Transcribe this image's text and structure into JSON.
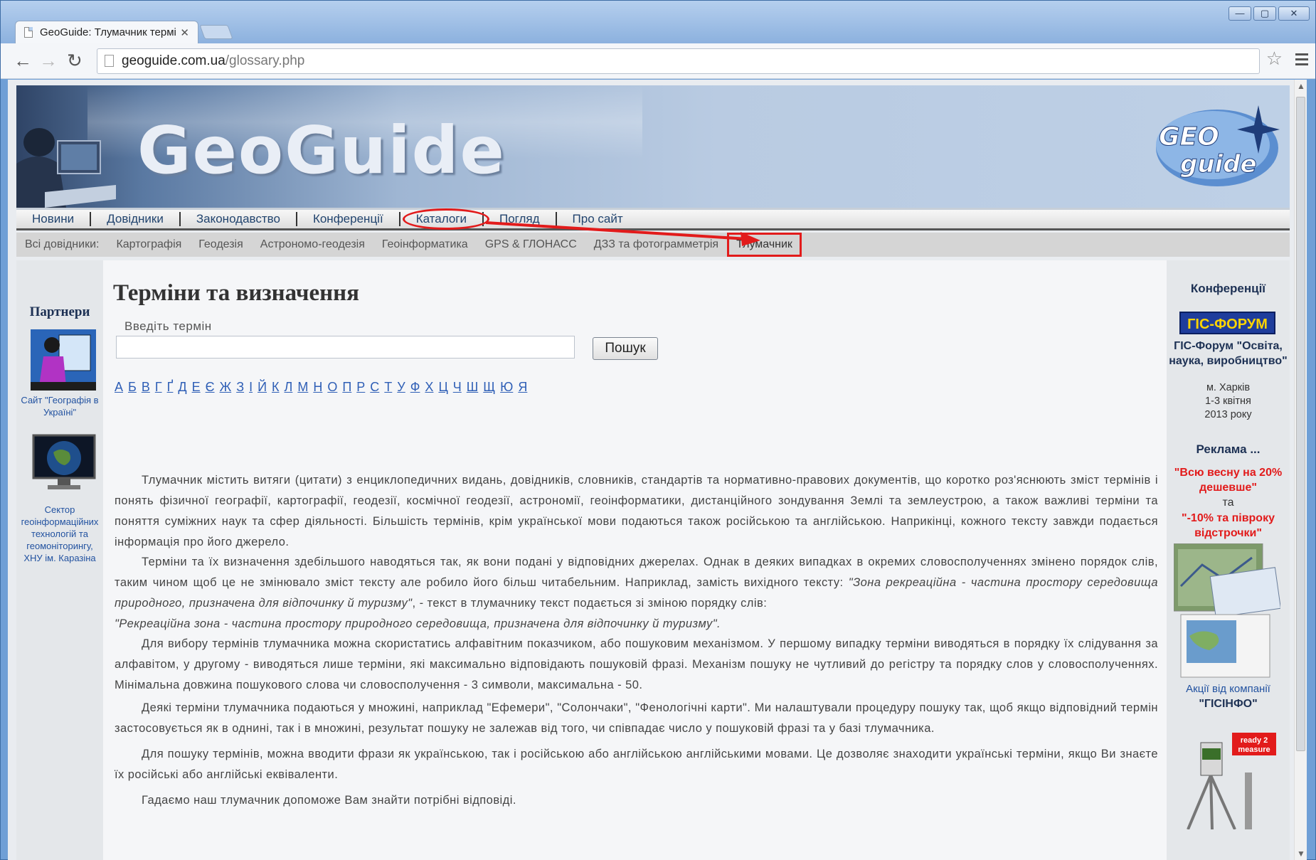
{
  "browser": {
    "tab_title": "GeoGuide: Тлумачник термі",
    "tab_close": "✕",
    "url_host": "geoguide.com.ua",
    "url_path": "/glossary.php",
    "window_buttons": [
      "—",
      "▢",
      "✕"
    ]
  },
  "site": {
    "logo_text": "GeoGuide",
    "badge_top": "GEO",
    "badge_bottom": "guide"
  },
  "nav_main": [
    "Новини",
    "Довідники",
    "Законодавство",
    "Конференції",
    "Каталоги",
    "Погляд",
    "Про сайт"
  ],
  "nav_sub": {
    "label": "Всі довідники:",
    "items": [
      "Картографія",
      "Геодезія",
      "Астрономо-геодезія",
      "Геоінформатика",
      "GPS & ГЛОНАСС",
      "ДЗЗ та фотограмметрія",
      "Тлумачник"
    ]
  },
  "left": {
    "title": "Партнери",
    "partner1": "Сайт \"Географія в Україні\"",
    "partner2": "Сектор геоінформаційних технологій та геомоніторингу, ХНУ ім. Каразіна"
  },
  "main": {
    "title": "Терміни та визначення",
    "search_label": "Введіть термін",
    "search_button": "Пошук",
    "alphabet": [
      "А",
      "Б",
      "В",
      "Г",
      "Ґ",
      "Д",
      "Е",
      "Є",
      "Ж",
      "З",
      "І",
      "Й",
      "К",
      "Л",
      "М",
      "Н",
      "О",
      "П",
      "Р",
      "С",
      "Т",
      "У",
      "Ф",
      "Х",
      "Ц",
      "Ч",
      "Ш",
      "Щ",
      "Ю",
      "Я"
    ],
    "p1": "Тлумачник містить витяги (цитати) з енциклопедичних видань, довідників, словників, стандартів та нормативно-правових документів, що коротко роз'яснюють зміст термінів і понять фізичної географії, картографії, геодезії, космічної геодезії, астрономії, геоінформатики, дистанційного зондування Землі та землеустрою, а також важливі терміни та поняття суміжних наук та сфер діяльності. Більшість термінів, крім української мови подаються також російською та англійською. Наприкінці, кожного тексту завжди подається інформація про його джерело.",
    "p2a": "Терміни та їх визначення здебільшого наводяться так, як вони подані у відповідних джерелах. Однак в деяких випадках в окремих словосполученнях змінено порядок слів, таким чином щоб це не змінювало зміст тексту але робило його більш читабельним. Наприклад, замість вихідного тексту: ",
    "p2b": "\"Зона рекреаційна - частина простору середовища природного, призначена для відпочинку й туризму\"",
    "p2c": ", - текст в тлумачнику текст подається зі зміною порядку слів:",
    "p2d": "\"Рекреаційна зона - частина простору природного середовища, призначена для відпочинку й туризму\".",
    "p3": "Для вибору термінів тлумачника можна скористатись алфавітним показчиком, або пошуковим механізмом. У першому випадку терміни виводяться в порядку їх слідування за алфавітом, у другому - виводяться лише терміни, які максимально відповідають пошуковій фразі. Механізм пошуку не чутливий до регістру та порядку слов у словосполученнях. Мінімальна довжина пошукового слова чи словосполучення - 3 символи, максимальна - 50.",
    "p4": "Деякі терміни тлумачника подаються у множині, наприклад \"Ефемери\", \"Солончаки\", \"Фенологічні карти\". Ми налаштували процедуру пошуку так, щоб якщо відповідний термін застосовується як в однині, так і в множині, результат пошуку не залежав від того, чи співпадає число у пошуковій фразі та у базі тлумачника.",
    "p5": "Для пошуку термінів, можна вводити фрази як українською, так і російською або англійською англійськими мовами. Це дозволяє знаходити українські терміни, якщо Ви знаєте їх російські або англійські еквіваленти.",
    "p6": "Гадаємо наш тлумачник допоможе Вам знайти потрібні відповіді."
  },
  "right": {
    "conf_title": "Конференції",
    "gis_logo": "ГІС-ФОРУМ",
    "conf_name": "ГІС-Форум \"Освіта, наука, виробництво\"",
    "conf_city": "м. Харків",
    "conf_date": "1-3 квітня",
    "conf_year": "2013 року",
    "ad_title": "Реклама ...",
    "ad1": "\"Всю весну на 20% дешевше\"",
    "ad_and": "та",
    "ad2": "\"-10% та півроку відстрочки\"",
    "ad_company": "Акції від компанії",
    "ad_company_name": "\"ГІСІНФО\"",
    "ready_badge": "ready 2 measure"
  },
  "colors": {
    "accent_red": "#e21b1b",
    "link_blue": "#2f5fb6",
    "nav_text": "#22446e"
  }
}
